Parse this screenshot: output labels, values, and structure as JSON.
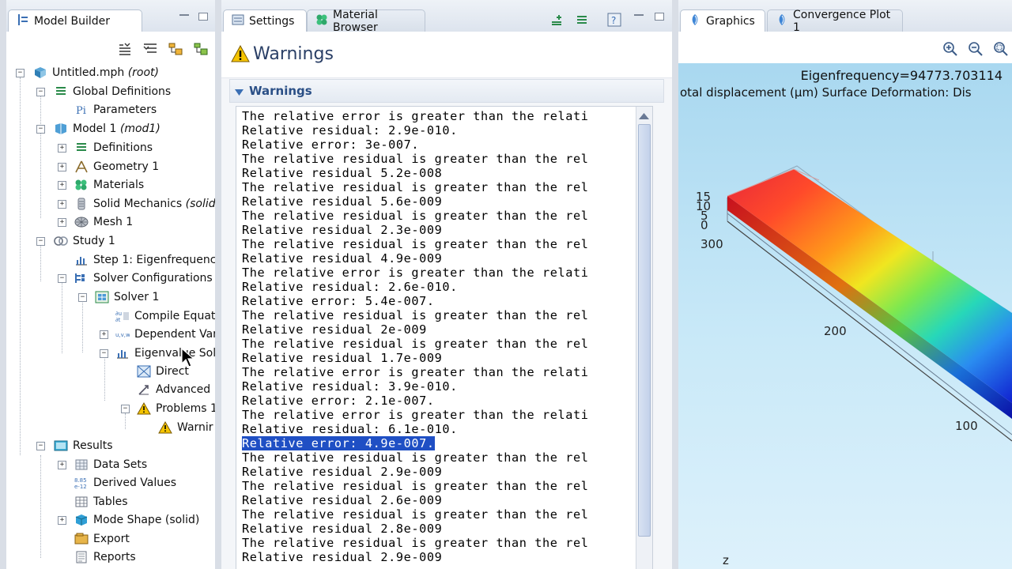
{
  "left_panel": {
    "tab_label": "Model Builder",
    "tree": [
      {
        "label": "Untitled.mph",
        "suffix": "(root)"
      },
      {
        "label": "Global Definitions",
        "suffix": ""
      },
      {
        "label": "Parameters",
        "suffix": ""
      },
      {
        "label": "Model 1",
        "suffix": "(mod1)"
      },
      {
        "label": "Definitions",
        "suffix": ""
      },
      {
        "label": "Geometry 1",
        "suffix": ""
      },
      {
        "label": "Materials",
        "suffix": ""
      },
      {
        "label": "Solid Mechanics",
        "suffix": "(solid)"
      },
      {
        "label": "Mesh 1",
        "suffix": ""
      },
      {
        "label": "Study 1",
        "suffix": ""
      },
      {
        "label": "Step 1: Eigenfrequenc",
        "suffix": ""
      },
      {
        "label": "Solver Configurations",
        "suffix": ""
      },
      {
        "label": "Solver 1",
        "suffix": ""
      },
      {
        "label": "Compile Equati",
        "suffix": ""
      },
      {
        "label": "Dependent Var",
        "suffix": ""
      },
      {
        "label": "Eigenvalue Sol",
        "suffix": ""
      },
      {
        "label": "Direct",
        "suffix": ""
      },
      {
        "label": "Advanced",
        "suffix": ""
      },
      {
        "label": "Problems 1",
        "suffix": ""
      },
      {
        "label": "Warnir",
        "suffix": ""
      },
      {
        "label": "Results",
        "suffix": ""
      },
      {
        "label": "Data Sets",
        "suffix": ""
      },
      {
        "label": "Derived Values",
        "suffix": ""
      },
      {
        "label": "Tables",
        "suffix": ""
      },
      {
        "label": "Mode Shape (solid)",
        "suffix": ""
      },
      {
        "label": "Export",
        "suffix": ""
      },
      {
        "label": "Reports",
        "suffix": ""
      }
    ]
  },
  "mid_panel": {
    "tabs": [
      "Settings",
      "Material Browser"
    ],
    "title": "Warnings",
    "section_label": "Warnings",
    "log_lines": [
      "The relative error is greater than the relati",
      "Relative residual: 2.9e-010.",
      "Relative error: 3e-007.",
      "The relative residual is greater than the rel",
      "Relative residual 5.2e-008",
      "The relative residual is greater than the rel",
      "Relative residual 5.6e-009",
      "The relative residual is greater than the rel",
      "Relative residual 2.3e-009",
      "The relative residual is greater than the rel",
      "Relative residual 4.9e-009",
      "The relative error is greater than the relati",
      "Relative residual: 2.6e-010.",
      "Relative error: 5.4e-007.",
      "The relative residual is greater than the rel",
      "Relative residual 2e-009",
      "The relative residual is greater than the rel",
      "Relative residual 1.7e-009",
      "The relative error is greater than the relati",
      "Relative residual: 3.9e-010.",
      "Relative error: 2.1e-007.",
      "The relative error is greater than the relati",
      "Relative residual: 6.1e-010.",
      "Relative error: 4.9e-007.",
      "The relative residual is greater than the rel",
      "Relative residual 2.9e-009",
      "The relative residual is greater than the rel",
      "Relative residual 2.6e-009",
      "The relative residual is greater than the rel",
      "Relative residual 2.8e-009",
      "The relative residual is greater than the rel",
      "Relative residual 2.9e-009"
    ],
    "selected_line_index": 23
  },
  "right_panel": {
    "tabs": [
      "Graphics",
      "Convergence Plot 1"
    ],
    "eigenfrequency_text": "Eigenfrequency=94773.703114",
    "subtitle_text": "otal displacement (μm)   Surface Deformation: Dis",
    "axis_labels": {
      "z_15": "15",
      "z_10": "10",
      "z_5": "5",
      "z_0": "0",
      "y_300": "300",
      "y_200": "200",
      "y_100": "100",
      "z_axis": "z"
    }
  },
  "colors": {
    "selection": "#1f4fc4",
    "warning_yellow": "#f5c400",
    "viewport_bg": "#bfe3f6"
  }
}
